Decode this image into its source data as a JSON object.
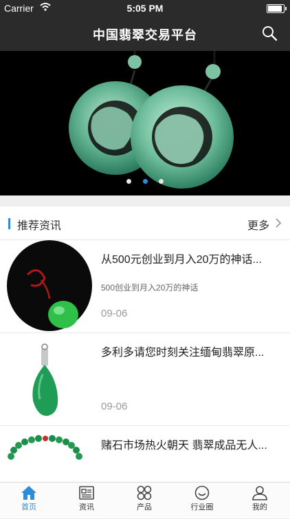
{
  "status": {
    "carrier": "Carrier",
    "time": "5:05 PM"
  },
  "nav": {
    "title": "中国翡翠交易平台"
  },
  "banner": {
    "page_count": 3,
    "active_page": 2
  },
  "section": {
    "title": "推荐资讯",
    "more": "更多"
  },
  "news": [
    {
      "title": "从500元创业到月入20万的神话...",
      "summary": "500创业到月入20万的神话",
      "date": "09-06",
      "thumb": "jade-pendant-black-thumb"
    },
    {
      "title": "多利多请您时刻关注缅甸翡翠原...",
      "summary": "",
      "date": "09-06",
      "thumb": "jade-drop-pendant-thumb"
    },
    {
      "title": "赌石市场热火朝天 翡翠成品无人...",
      "summary": "",
      "date": "",
      "thumb": "jade-bead-necklace-thumb"
    }
  ],
  "tabs": [
    {
      "label": "首页",
      "icon": "home-icon",
      "active": true
    },
    {
      "label": "资讯",
      "icon": "news-icon",
      "active": false
    },
    {
      "label": "产品",
      "icon": "products-icon",
      "active": false
    },
    {
      "label": "行业圈",
      "icon": "community-icon",
      "active": false
    },
    {
      "label": "我的",
      "icon": "profile-icon",
      "active": false
    }
  ],
  "colors": {
    "accent": "#2e8bd6",
    "navbar": "#2b2b2b",
    "jade": "#2fa864"
  }
}
